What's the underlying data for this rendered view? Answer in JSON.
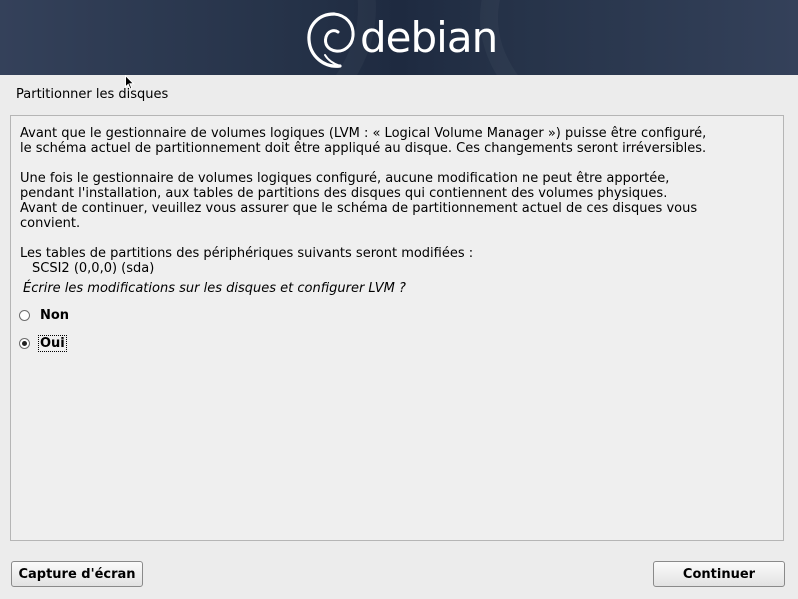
{
  "banner": {
    "logo_text": "debian",
    "logo_icon": "debian-swirl-icon"
  },
  "page_title": "Partitionner les disques",
  "content": {
    "paragraph1": "Avant que le gestionnaire de volumes logiques (LVM : « Logical Volume Manager ») puisse être configuré,\nle schéma actuel de partitionnement doit être appliqué au disque. Ces changements seront irréversibles.",
    "paragraph2": "Une fois le gestionnaire de volumes logiques configuré, aucune modification ne peut être apportée,\npendant l'installation, aux tables de partitions des disques qui contiennent des volumes physiques.\nAvant de continuer, veuillez vous assurer que le schéma de partitionnement actuel de ces disques vous\nconvient.",
    "paragraph3": "Les tables de partitions des périphériques suivants seront modifiées :",
    "device": "SCSI2 (0,0,0) (sda)",
    "question": "Écrire les modifications sur les disques et configurer LVM ?",
    "options": [
      {
        "label": "Non",
        "selected": false
      },
      {
        "label": "Oui",
        "selected": true
      }
    ]
  },
  "buttons": {
    "screenshot_label": "Capture d'écran",
    "continue_label": "Continuer"
  },
  "colors": {
    "banner_bg": "#263349",
    "page_bg": "#ececec"
  }
}
